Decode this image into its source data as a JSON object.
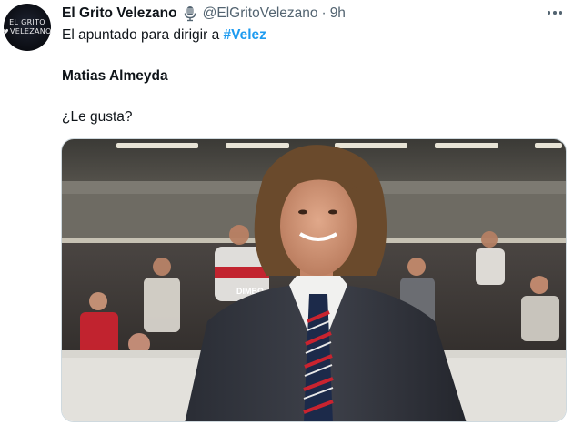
{
  "tweet": {
    "avatar": {
      "line1": "EL GRITO",
      "line2": "VELEZANO"
    },
    "display_name": "El Grito Velezano",
    "handle": "@ElGritoVelezano",
    "separator": "·",
    "time": "9h",
    "text_line1_prefix": "El apuntado para dirigir a ",
    "hashtag": "#Velez",
    "text_line2": "Matias Almeyda",
    "text_line3": "¿Le gusta?",
    "media_banner_text": "DIMBO"
  },
  "icons": {
    "verified_badge": "microphone-icon",
    "more": "more-horizontal-icon"
  },
  "colors": {
    "text_primary": "#0f1419",
    "text_secondary": "#536471",
    "link": "#1d9bf0"
  }
}
